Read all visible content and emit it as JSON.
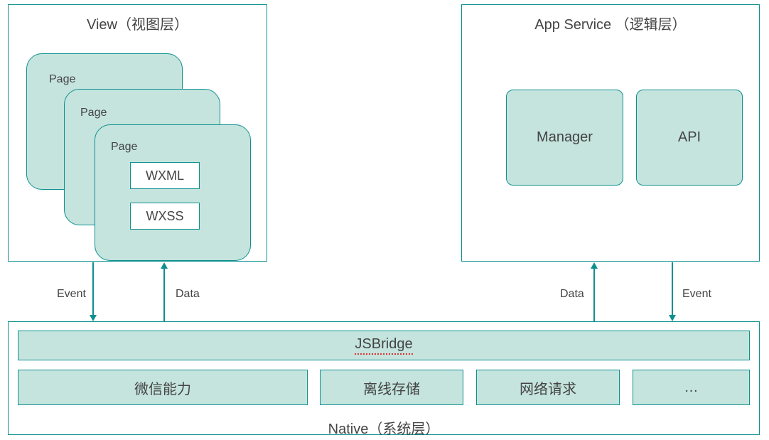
{
  "view": {
    "title": "View（视图层）",
    "pages": [
      "Page",
      "Page",
      "Page"
    ],
    "inner": {
      "wxml": "WXML",
      "wxss": "WXSS"
    }
  },
  "appservice": {
    "title": "App Service （逻辑层）",
    "boxes": {
      "manager": "Manager",
      "api": "API"
    }
  },
  "arrows": {
    "view_down": "Event",
    "view_up": "Data",
    "service_up": "Data",
    "service_down": "Event"
  },
  "native": {
    "title": "Native（系统层）",
    "jsbridge": "JSBridge",
    "blocks": {
      "wechat": "微信能力",
      "storage": "离线存储",
      "network": "网络请求",
      "more": "…"
    }
  }
}
